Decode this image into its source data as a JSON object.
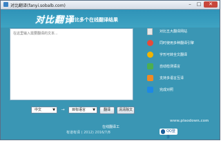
{
  "window": {
    "title": "对比翻译(fanyi.sobalb.com)",
    "minimize": "–",
    "maximize": "□",
    "close": "✕"
  },
  "header": {
    "logo": "对比翻译",
    "slogan": "对比多个在线翻译结果"
  },
  "editor": {
    "placeholder": "在这里输入需要翻译的文本..."
  },
  "sidebar": {
    "items": [
      {
        "label": "对比五大翻译网站",
        "icon": "compare-icon",
        "color": "#e8e8e8"
      },
      {
        "label": "同时使用多种翻译引擎",
        "icon": "engines-icon",
        "color": "#e84a3a"
      },
      {
        "label": "字形可转全文翻译",
        "icon": "glyph-icon",
        "color": "#f0b400"
      },
      {
        "label": "自动检测语言",
        "icon": "detect-icon",
        "color": "#4caf50"
      },
      {
        "label": "支持多语言互译",
        "icon": "languages-icon",
        "color": "#f08a24"
      },
      {
        "label": "完成对照",
        "icon": "check-icon",
        "color": "#1e88e5"
      }
    ]
  },
  "controls": {
    "source_lang": "中文",
    "swap": "→",
    "target_lang": "目标语言",
    "translate": "翻译",
    "clear": "清清除文"
  },
  "footer": {
    "link": "在线翻译工",
    "copyright": "有道有译 ( 2012) 2016/7/8",
    "qq": "QQ登录",
    "watermark": "www.piaodown.com"
  }
}
